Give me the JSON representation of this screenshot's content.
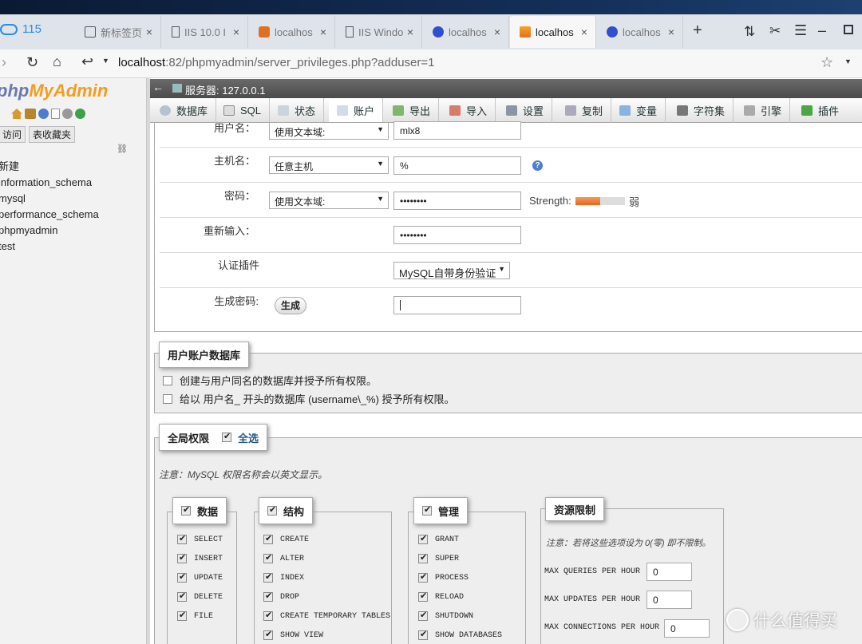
{
  "browser": {
    "logo_text": "115",
    "tabs": [
      {
        "label": "新标签页",
        "active": false
      },
      {
        "label": "IIS 10.0 I",
        "active": false
      },
      {
        "label": "localhos",
        "active": false
      },
      {
        "label": "IIS Windo",
        "active": false
      },
      {
        "label": "localhos",
        "active": false
      },
      {
        "label": "localhos",
        "active": false,
        "current": true
      },
      {
        "label": "localhos",
        "active": false
      }
    ],
    "new_tab": "+",
    "url_host": "localhost",
    "url_rest": ":82/phpmyadmin/server_privileges.php?adduser=1"
  },
  "sidebar": {
    "logo_a": "php",
    "logo_b": "MyAdmin",
    "recent_btn": "访问",
    "favorites_btn": "表收藏夹",
    "items": [
      "新建",
      "information_schema",
      "mysql",
      "performance_schema",
      "phpmyadmin",
      "test"
    ]
  },
  "server": {
    "title": "服务器: 127.0.0.1"
  },
  "menu": [
    {
      "label": "数据库"
    },
    {
      "label": "SQL"
    },
    {
      "label": "状态"
    },
    {
      "label": "账户"
    },
    {
      "label": "导出"
    },
    {
      "label": "导入"
    },
    {
      "label": "设置"
    },
    {
      "label": "复制"
    },
    {
      "label": "变量"
    },
    {
      "label": "字符集"
    },
    {
      "label": "引擎"
    },
    {
      "label": "插件"
    }
  ],
  "login": {
    "username_label": "用户名：",
    "username_select": "使用文本域:",
    "username_value": "mlx8",
    "host_label": "主机名：",
    "host_select": "任意主机",
    "host_value": "%",
    "password_label": "密码：",
    "password_select": "使用文本域:",
    "password_value": "••••••••",
    "strength_label": "Strength:",
    "strength_value": "弱",
    "strength_fraction": 0.5,
    "retype_label": "重新输入：",
    "retype_value": "••••••••",
    "auth_label": "认证插件",
    "auth_value": "MySQL自带身份验证",
    "generate_label": "生成密码:",
    "generate_button": "生成"
  },
  "userdb": {
    "legend": "用户账户数据库",
    "opt1": "创建与用户同名的数据库并授予所有权限。",
    "opt2": "给以 用户名_ 开头的数据库 (username\\_%) 授予所有权限。"
  },
  "global": {
    "legend": "全局权限",
    "select_all": "全选",
    "note": "注意：MySQL 权限名称会以英文显示。",
    "data": {
      "legend": "数据",
      "items": [
        "SELECT",
        "INSERT",
        "UPDATE",
        "DELETE",
        "FILE"
      ]
    },
    "structure": {
      "legend": "结构",
      "items": [
        "CREATE",
        "ALTER",
        "INDEX",
        "DROP",
        "CREATE TEMPORARY TABLES",
        "SHOW VIEW"
      ]
    },
    "admin": {
      "legend": "管理",
      "items": [
        "GRANT",
        "SUPER",
        "PROCESS",
        "RELOAD",
        "SHUTDOWN",
        "SHOW DATABASES"
      ]
    },
    "limits": {
      "legend": "资源限制",
      "note": "注意：若将这些选项设为 0(零) 即不限制。",
      "rows": [
        {
          "label": "MAX QUERIES PER HOUR",
          "value": "0"
        },
        {
          "label": "MAX UPDATES PER HOUR",
          "value": "0"
        },
        {
          "label": "MAX CONNECTIONS PER HOUR",
          "value": "0"
        }
      ]
    }
  },
  "watermark": "什么值得买",
  "colors": {
    "accent_orange": "#f07d28",
    "link_blue": "#235a81"
  }
}
